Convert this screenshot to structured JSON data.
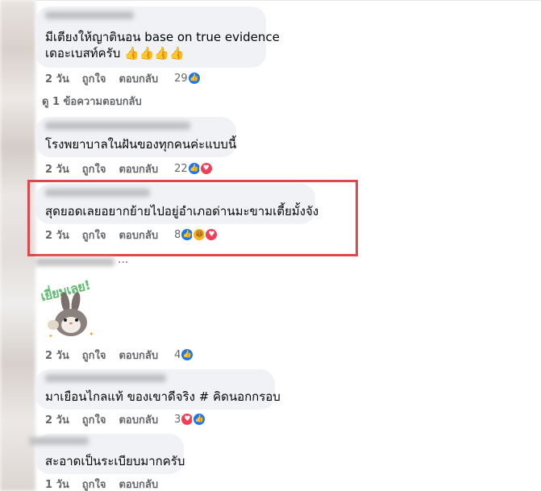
{
  "comments": [
    {
      "text_lines": [
        "มีเตียงให้ญาตินอน base on true evidence",
        "เดอะเบสท์ครับ 👍👍👍👍"
      ],
      "time": "2 วัน",
      "like": "ถูกใจ",
      "reply": "ตอบกลับ",
      "reaction_count": "29",
      "reactions": [
        "like-icon"
      ]
    },
    {
      "text_lines": [
        "โรงพยาบาลในฝันของทุกคนค่ะแบบนี้"
      ],
      "time": "2 วัน",
      "like": "ถูกใจ",
      "reply": "ตอบกลับ",
      "reaction_count": "22",
      "reactions": [
        "like-icon",
        "love-icon"
      ]
    },
    {
      "text_lines": [
        "สุดยอดเลยอยากย้ายไปอยู่อำเภอด่านมะขามเตี้ยมั้งจัง"
      ],
      "time": "2 วัน",
      "like": "ถูกใจ",
      "reply": "ตอบกลับ",
      "reaction_count": "8",
      "reactions": [
        "like-icon",
        "haha-icon",
        "love-icon"
      ]
    },
    {
      "sticker_text": "เยี่ยมเลย!",
      "time": "2 วัน",
      "like": "ถูกใจ",
      "reply": "ตอบกลับ",
      "reaction_count": "4",
      "reactions": [
        "like-icon"
      ]
    },
    {
      "text_lines": [
        "มาเยือนไกลแท้ ของเขาดีจริง # คิดนอกกรอบ"
      ],
      "time": "2 วัน",
      "like": "ถูกใจ",
      "reply": "ตอบกลับ",
      "reaction_count": "3",
      "reactions": [
        "love-icon",
        "like-icon"
      ]
    },
    {
      "text_lines": [
        "สะอาดเป็นระเบียบมากครับ"
      ],
      "time": "1 วัน",
      "like": "ถูกใจ",
      "reply": "ตอบกลับ",
      "reaction_count": "",
      "reactions": []
    }
  ],
  "view_replies": "ดู 1 ข้อความตอบกลับ",
  "ellipsis": "...",
  "colors": {
    "accent": "#1877f2",
    "love": "#f33e58",
    "haha": "#f7b125",
    "highlight_border": "#e0474c",
    "bubble": "#f0f2f5"
  }
}
